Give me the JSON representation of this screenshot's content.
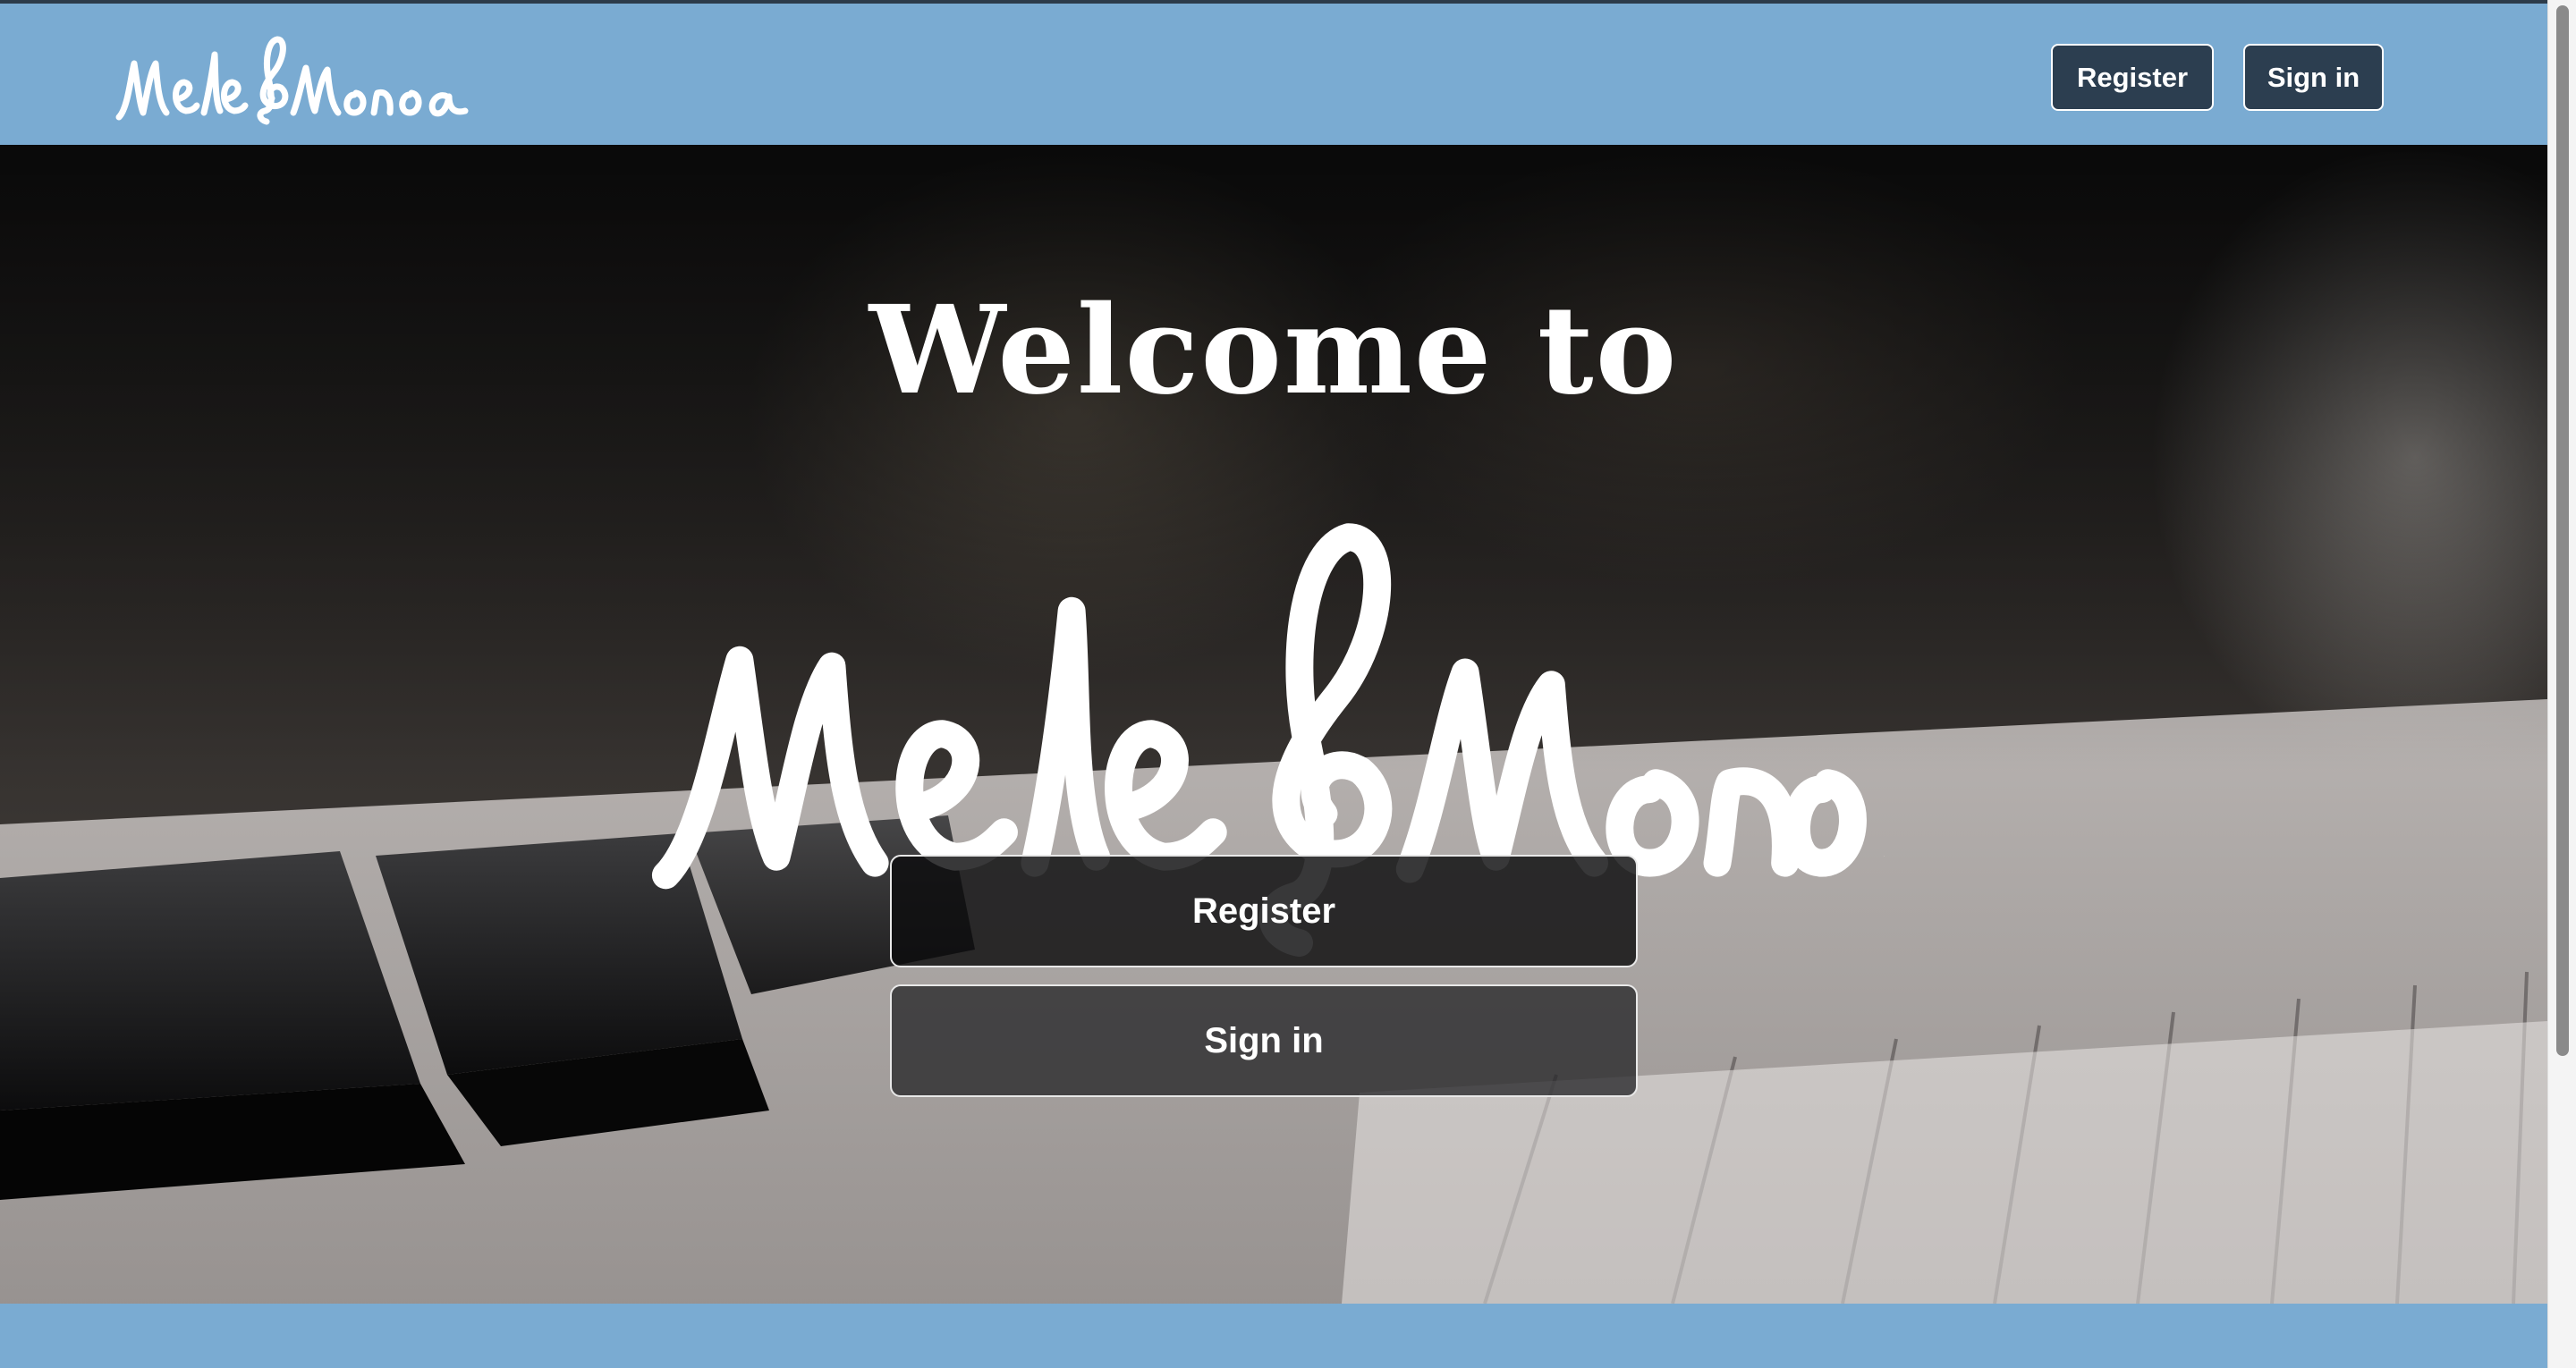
{
  "brand": {
    "logo_text": "Mele§Manoa",
    "logo_alt": "MeleManoa"
  },
  "navbar": {
    "register_label": "Register",
    "signin_label": "Sign in"
  },
  "hero": {
    "title": "Welcome to",
    "register_label": "Register",
    "signin_label": "Sign in"
  },
  "colors": {
    "navbar_bg": "#7aabd2",
    "nav_button_bg": "#2c3e50",
    "hero_button_bg": "#0c0c0e",
    "text": "#ffffff"
  },
  "icons": {
    "logo_glyph": "treble-clef-icon"
  }
}
